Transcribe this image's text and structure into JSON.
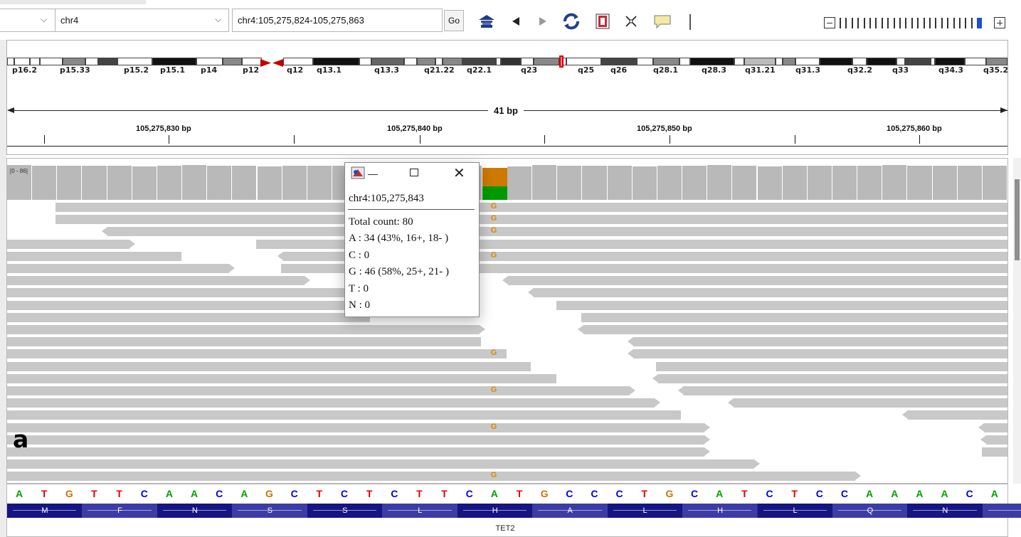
{
  "toolbar": {
    "genome_value": "",
    "chromosome_value": "chr4",
    "locus_value": "chr4:105,275,824-105,275,863",
    "go_label": "Go",
    "icons": [
      "home-icon",
      "back-arrow-icon",
      "forward-arrow-icon",
      "refresh-icon",
      "roi-icon",
      "resize-icon",
      "popup-balloon-icon",
      "zoom-out-icon",
      "zoom-in-icon"
    ]
  },
  "ideogram": {
    "band_labels": [
      "p16.2",
      "p15.33",
      "p15.2",
      "p15.1",
      "p14",
      "p12",
      "q12",
      "q13.1",
      "q13.3",
      "q21.22",
      "q22.1",
      "q23",
      "q25",
      "q26",
      "q28.1",
      "q28.3",
      "q31.21",
      "q31.3",
      "q32.2",
      "q33",
      "q34.3",
      "q35.2"
    ]
  },
  "ruler": {
    "span_label": "41 bp",
    "position_labels": [
      "105,275,830 bp",
      "105,275,840 bp",
      "105,275,850 bp",
      "105,275,860 bp"
    ]
  },
  "coverage": {
    "range_label": "[0 - 86]"
  },
  "alignments": {
    "mismatch_base": "G"
  },
  "popup": {
    "locus": "chr4:105,275,843",
    "total": "Total count: 80",
    "a": "A : 34 (43%, 16+, 18- )",
    "c": "C : 0",
    "g": "G : 46 (58%, 25+, 21- )",
    "t": "T : 0",
    "n": "N : 0"
  },
  "panel_letter": "a",
  "sequence": [
    "A",
    "T",
    "G",
    "T",
    "T",
    "C",
    "A",
    "A",
    "C",
    "A",
    "G",
    "C",
    "T",
    "C",
    "T",
    "C",
    "T",
    "T",
    "C",
    "A",
    "T",
    "G",
    "C",
    "C",
    "C",
    "T",
    "G",
    "C",
    "A",
    "T",
    "C",
    "T",
    "C",
    "C",
    "A",
    "A",
    "A",
    "A",
    "C",
    "A"
  ],
  "base_colors": {
    "A": "#00a000",
    "C": "#0000e0",
    "G": "#d17100",
    "T": "#e00000"
  },
  "amino_acids": [
    "M",
    "F",
    "N",
    "S",
    "S",
    "L",
    "H",
    "A",
    "L",
    "H",
    "L",
    "Q",
    "N"
  ],
  "gene_name": "TET2"
}
